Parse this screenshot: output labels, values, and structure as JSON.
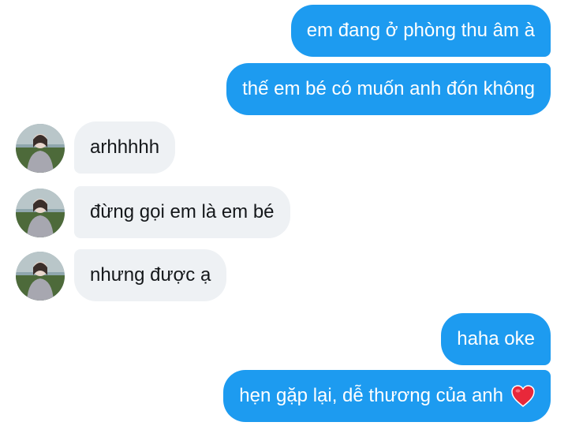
{
  "conversation": {
    "messages": [
      {
        "direction": "outgoing",
        "text": "em đang ở phòng thu âm à"
      },
      {
        "direction": "outgoing",
        "text": "thế em bé có muốn anh đón không"
      },
      {
        "direction": "incoming",
        "text": "arhhhhh",
        "avatar": "contact-avatar-photo"
      },
      {
        "direction": "incoming",
        "text": "đừng gọi em là em bé",
        "avatar": "contact-avatar-photo"
      },
      {
        "direction": "incoming",
        "text": "nhưng được ạ",
        "avatar": "contact-avatar-photo"
      },
      {
        "direction": "outgoing",
        "text": "haha oke"
      },
      {
        "direction": "outgoing",
        "text": "hẹn gặp lại, dễ thương của anh",
        "emoji": "red-heart-icon"
      }
    ]
  },
  "colors": {
    "outgoing_bubble": "#1d9bf0",
    "incoming_bubble": "#eef1f4",
    "heart": "#e8283a"
  }
}
